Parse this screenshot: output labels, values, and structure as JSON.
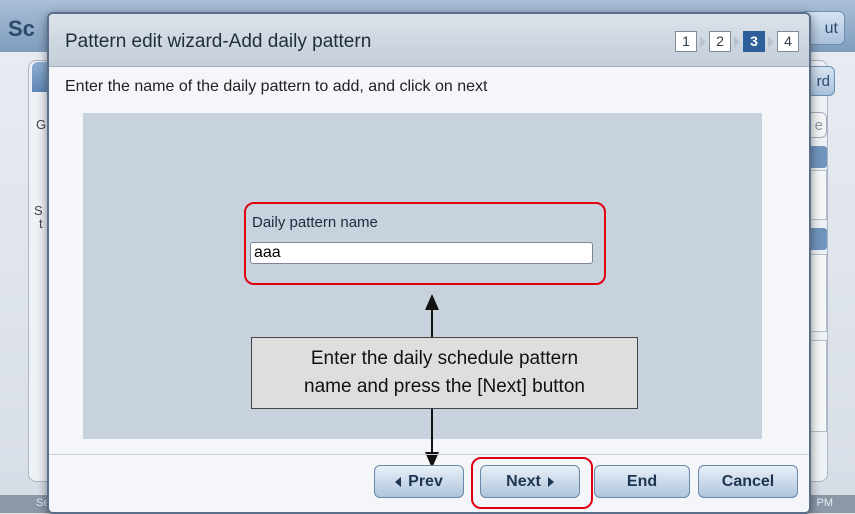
{
  "background": {
    "title_fragment": "Sc",
    "logout_fragment": "ut",
    "wizard_fragment": "rd",
    "left_fragments": [
      "G",
      "S",
      "t"
    ],
    "edit_fragment": "e",
    "status_left": "Se",
    "status_right": "PM"
  },
  "dialog": {
    "title": "Pattern edit wizard-Add daily pattern",
    "steps": [
      "1",
      "2",
      "3",
      "4"
    ],
    "active_step": "3",
    "instruction": "Enter the name of the daily pattern to add, and click on next",
    "field_label": "Daily pattern name",
    "field_value": "aaa",
    "buttons": {
      "prev": "Prev",
      "next": "Next",
      "end": "End",
      "cancel": "Cancel"
    }
  },
  "callout": {
    "text": "Enter the daily schedule pattern\nname and press the [Next] button"
  },
  "colors": {
    "highlight": "#e00012",
    "active_step": "#2d5f9a",
    "content_bg": "#c8d2de"
  },
  "icons": {
    "prev": "triangle-left-icon",
    "next": "triangle-right-icon",
    "step_separator": "chevron-right-icon"
  }
}
